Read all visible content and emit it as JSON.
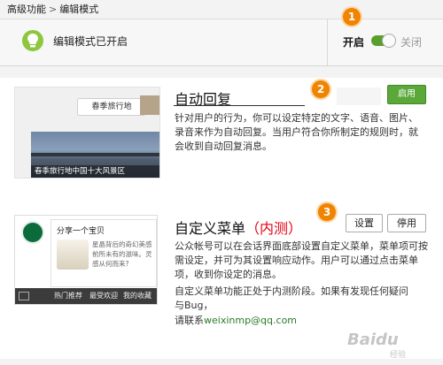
{
  "breadcrumb": {
    "parent": "高级功能",
    "separator": ">",
    "current": "编辑模式"
  },
  "mode_bar": {
    "status_text": "编辑模式已开启",
    "on_label": "开启",
    "off_label": "关闭",
    "toggle_state": "on"
  },
  "badges": [
    "1",
    "2",
    "3"
  ],
  "auto_reply": {
    "thumb_bubble": "春季旅行地",
    "thumb_caption": "春季旅行地中国十大风景区",
    "title": "自动回复",
    "description": "针对用户的行为，你可以设定特定的文字、语音、图片、录音来作为自动回复。当用户符合你所制定的规则时，就会收到自动回复消息。",
    "enable_button": "启用"
  },
  "custom_menu": {
    "thumb_card_title": "分享一个宝贝",
    "thumb_card_text": "星晶背后的奇幻美感前所未有的滋味。灵感从何而来?",
    "thumb_menu": [
      "热门推荐",
      "最受欢迎",
      "我的收藏"
    ],
    "title": "自定义菜单",
    "title_note": "（内测）",
    "settings_button": "设置",
    "disable_button": "停用",
    "description": "公众帐号可以在会话界面底部设置自定义菜单，菜单项可按需设定，并可为其设置响应动作。用户可以通过点击菜单项，收到你设定的消息。",
    "note_prefix": "自定义菜单功能正处于内测阶段。如果有发现任何疑问与Bug，",
    "contact_prefix": "请联系",
    "contact_email": "weixinmp@qq.com"
  },
  "watermark": {
    "logo": "Baidu",
    "sub": "经验"
  },
  "colors": {
    "accent_green": "#5aa73a",
    "badge_orange": "#f08300",
    "note_red": "#e60012"
  }
}
